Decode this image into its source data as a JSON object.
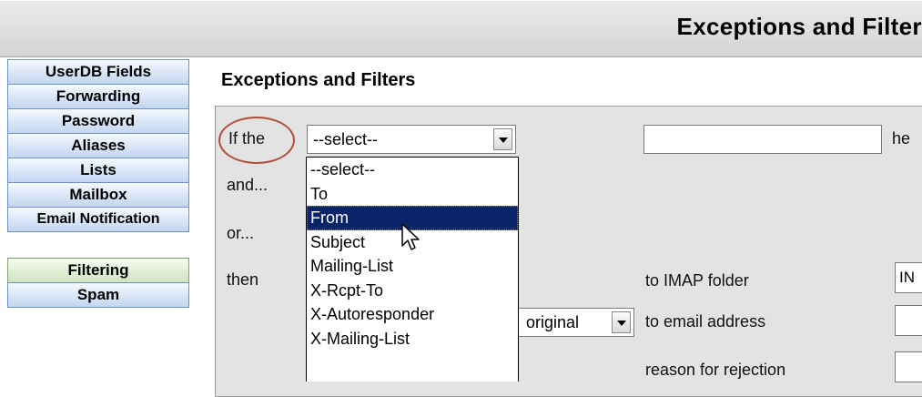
{
  "header": {
    "title": "Exceptions and Filters (t"
  },
  "sidebar": {
    "items": [
      {
        "label": "UserDB Fields"
      },
      {
        "label": "Forwarding"
      },
      {
        "label": "Password"
      },
      {
        "label": "Aliases"
      },
      {
        "label": "Lists"
      },
      {
        "label": "Mailbox"
      },
      {
        "label": "Email Notification"
      },
      {
        "label": "Filtering"
      },
      {
        "label": "Spam"
      }
    ]
  },
  "main": {
    "section_title": "Exceptions and Filters",
    "rule_labels": {
      "if_the": "If the",
      "and": "and...",
      "or": "or...",
      "then": "then",
      "header_suffix": "he"
    },
    "header_select": {
      "value": "--select--",
      "options": [
        "--select--",
        "To",
        "From",
        "Subject",
        "Mailing-List",
        "X-Rcpt-To",
        "X-Autoresponder",
        "X-Mailing-List"
      ],
      "highlighted": "From"
    },
    "actions": {
      "imap_label": "to IMAP folder",
      "imap_value": "IN",
      "email_label": "to email address",
      "copy_select_value": "original",
      "reject_label": "reason for rejection"
    }
  }
}
